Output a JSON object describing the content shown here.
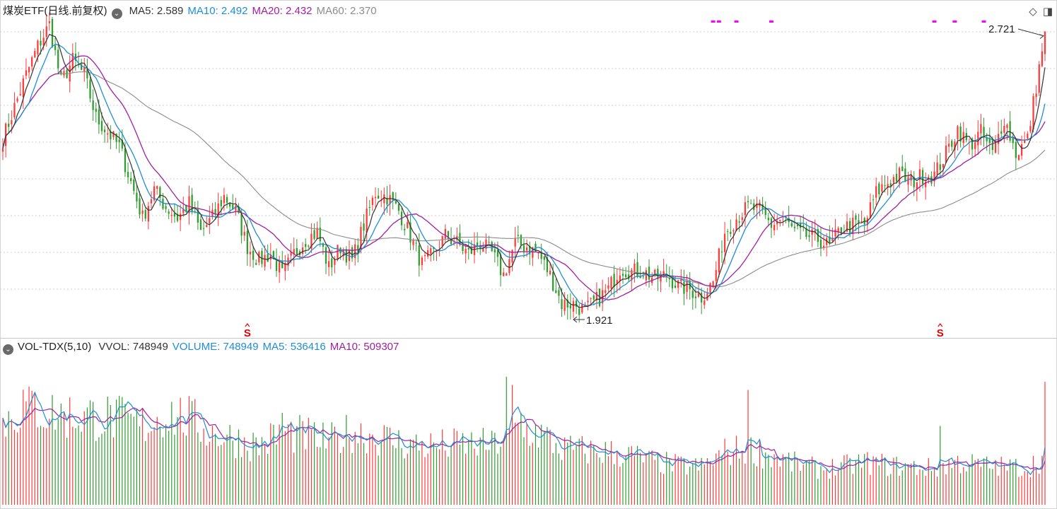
{
  "price_panel": {
    "title": "煤炭ETF(日线.前复权)",
    "ma_labels": [
      {
        "text": "MA5: 2.589",
        "color": "#333333"
      },
      {
        "text": "MA10: 2.492",
        "color": "#1f8dd6"
      },
      {
        "text": "MA20: 2.432",
        "color": "#a020a0"
      },
      {
        "text": "MA60: 2.370",
        "color": "#8c8c8c"
      }
    ],
    "high_label": "2.721",
    "low_label": "1.921",
    "signal_marker": "S"
  },
  "volume_panel": {
    "title": "VOL-TDX(5,10)",
    "labels": [
      {
        "text": "VVOL: 748949",
        "color": "#333333"
      },
      {
        "text": "VOLUME: 748949",
        "color": "#1f8dd6"
      },
      {
        "text": "MA5: 536416",
        "color": "#1f8dd6"
      },
      {
        "text": "MA10: 509307",
        "color": "#a020a0"
      }
    ]
  },
  "icons": [
    "collapse-circle-icon",
    "diamond-icon",
    "panel-toggle-icon"
  ],
  "colors": {
    "up": "#ff3a3a",
    "down": "#2e9d2e",
    "ma5": "#333333",
    "ma10": "#1f8dd6",
    "ma20": "#a020a0",
    "ma60": "#8c8c8c",
    "marker": "#ff00ff"
  },
  "chart_data": {
    "type": "candlestick",
    "price_range": [
      1.9,
      2.75
    ],
    "price_anchors": [
      [
        0,
        2.42
      ],
      [
        8,
        2.6
      ],
      [
        12,
        2.68
      ],
      [
        16,
        2.74
      ],
      [
        20,
        2.58
      ],
      [
        24,
        2.64
      ],
      [
        28,
        2.6
      ],
      [
        32,
        2.48
      ],
      [
        36,
        2.44
      ],
      [
        40,
        2.4
      ],
      [
        44,
        2.3
      ],
      [
        48,
        2.2
      ],
      [
        52,
        2.28
      ],
      [
        56,
        2.23
      ],
      [
        60,
        2.2
      ],
      [
        64,
        2.24
      ],
      [
        68,
        2.16
      ],
      [
        72,
        2.2
      ],
      [
        76,
        2.26
      ],
      [
        80,
        2.22
      ],
      [
        84,
        2.12
      ],
      [
        88,
        2.08
      ],
      [
        92,
        2.1
      ],
      [
        96,
        2.04
      ],
      [
        100,
        2.1
      ],
      [
        104,
        2.14
      ],
      [
        108,
        2.16
      ],
      [
        112,
        2.06
      ],
      [
        116,
        2.12
      ],
      [
        120,
        2.08
      ],
      [
        124,
        2.18
      ],
      [
        128,
        2.27
      ],
      [
        132,
        2.26
      ],
      [
        136,
        2.22
      ],
      [
        140,
        2.15
      ],
      [
        144,
        2.07
      ],
      [
        148,
        2.1
      ],
      [
        152,
        2.15
      ],
      [
        156,
        2.13
      ],
      [
        160,
        2.1
      ],
      [
        164,
        2.13
      ],
      [
        168,
        2.1
      ],
      [
        172,
        2.04
      ],
      [
        176,
        2.13
      ],
      [
        180,
        2.12
      ],
      [
        184,
        2.1
      ],
      [
        188,
        2.04
      ],
      [
        192,
        1.96
      ],
      [
        196,
        1.96
      ],
      [
        200,
        1.94
      ],
      [
        204,
        1.97
      ],
      [
        208,
        2.0
      ],
      [
        212,
        2.06
      ],
      [
        216,
        2.05
      ],
      [
        220,
        2.05
      ],
      [
        224,
        2.03
      ],
      [
        228,
        2.04
      ],
      [
        232,
        2.01
      ],
      [
        236,
        2.0
      ],
      [
        240,
        1.98
      ],
      [
        244,
        2.02
      ],
      [
        248,
        2.16
      ],
      [
        252,
        2.2
      ],
      [
        256,
        2.23
      ],
      [
        260,
        2.22
      ],
      [
        264,
        2.18
      ],
      [
        268,
        2.2
      ],
      [
        272,
        2.16
      ],
      [
        276,
        2.15
      ],
      [
        280,
        2.14
      ],
      [
        284,
        2.12
      ],
      [
        288,
        2.17
      ],
      [
        292,
        2.18
      ],
      [
        296,
        2.18
      ],
      [
        300,
        2.27
      ],
      [
        304,
        2.3
      ],
      [
        308,
        2.32
      ],
      [
        312,
        2.3
      ],
      [
        316,
        2.32
      ],
      [
        320,
        2.32
      ],
      [
        324,
        2.38
      ],
      [
        328,
        2.45
      ],
      [
        332,
        2.4
      ],
      [
        336,
        2.44
      ],
      [
        340,
        2.38
      ],
      [
        344,
        2.48
      ],
      [
        348,
        2.38
      ],
      [
        352,
        2.42
      ],
      [
        354,
        2.52
      ],
      [
        356,
        2.62
      ],
      [
        358,
        2.721
      ]
    ],
    "volume_range": [
      0,
      900000
    ],
    "volume_anchors": [
      [
        0,
        500000
      ],
      [
        8,
        620000
      ],
      [
        16,
        560000
      ],
      [
        24,
        540000
      ],
      [
        32,
        540000
      ],
      [
        40,
        520000
      ],
      [
        48,
        480000
      ],
      [
        56,
        560000
      ],
      [
        64,
        520000
      ],
      [
        72,
        440000
      ],
      [
        80,
        400000
      ],
      [
        88,
        360000
      ],
      [
        96,
        440000
      ],
      [
        104,
        420000
      ],
      [
        112,
        380000
      ],
      [
        120,
        450000
      ],
      [
        128,
        420000
      ],
      [
        136,
        380000
      ],
      [
        144,
        360000
      ],
      [
        152,
        360000
      ],
      [
        160,
        370000
      ],
      [
        168,
        360000
      ],
      [
        176,
        460000
      ],
      [
        184,
        440000
      ],
      [
        192,
        340000
      ],
      [
        200,
        330000
      ],
      [
        208,
        320000
      ],
      [
        216,
        300000
      ],
      [
        224,
        260000
      ],
      [
        232,
        240000
      ],
      [
        240,
        230000
      ],
      [
        248,
        320000
      ],
      [
        256,
        340000
      ],
      [
        264,
        300000
      ],
      [
        272,
        250000
      ],
      [
        280,
        220000
      ],
      [
        288,
        230000
      ],
      [
        296,
        260000
      ],
      [
        304,
        240000
      ],
      [
        312,
        230000
      ],
      [
        320,
        220000
      ],
      [
        328,
        260000
      ],
      [
        336,
        240000
      ],
      [
        344,
        230000
      ],
      [
        352,
        230000
      ],
      [
        358,
        290000
      ]
    ],
    "volume_spikes": [
      [
        173,
        780000
      ],
      [
        175,
        730000
      ],
      [
        178,
        560000
      ],
      [
        256,
        700000
      ],
      [
        322,
        480000
      ],
      [
        96,
        560000
      ],
      [
        9,
        720000
      ]
    ],
    "bars": 359,
    "signal_markers_index": [
      84,
      322
    ],
    "magenta_marks_index": [
      244,
      246,
      252,
      264,
      320,
      327,
      337
    ],
    "series": [
      {
        "name": "MA5"
      },
      {
        "name": "MA10"
      },
      {
        "name": "MA20"
      },
      {
        "name": "MA60"
      }
    ]
  }
}
